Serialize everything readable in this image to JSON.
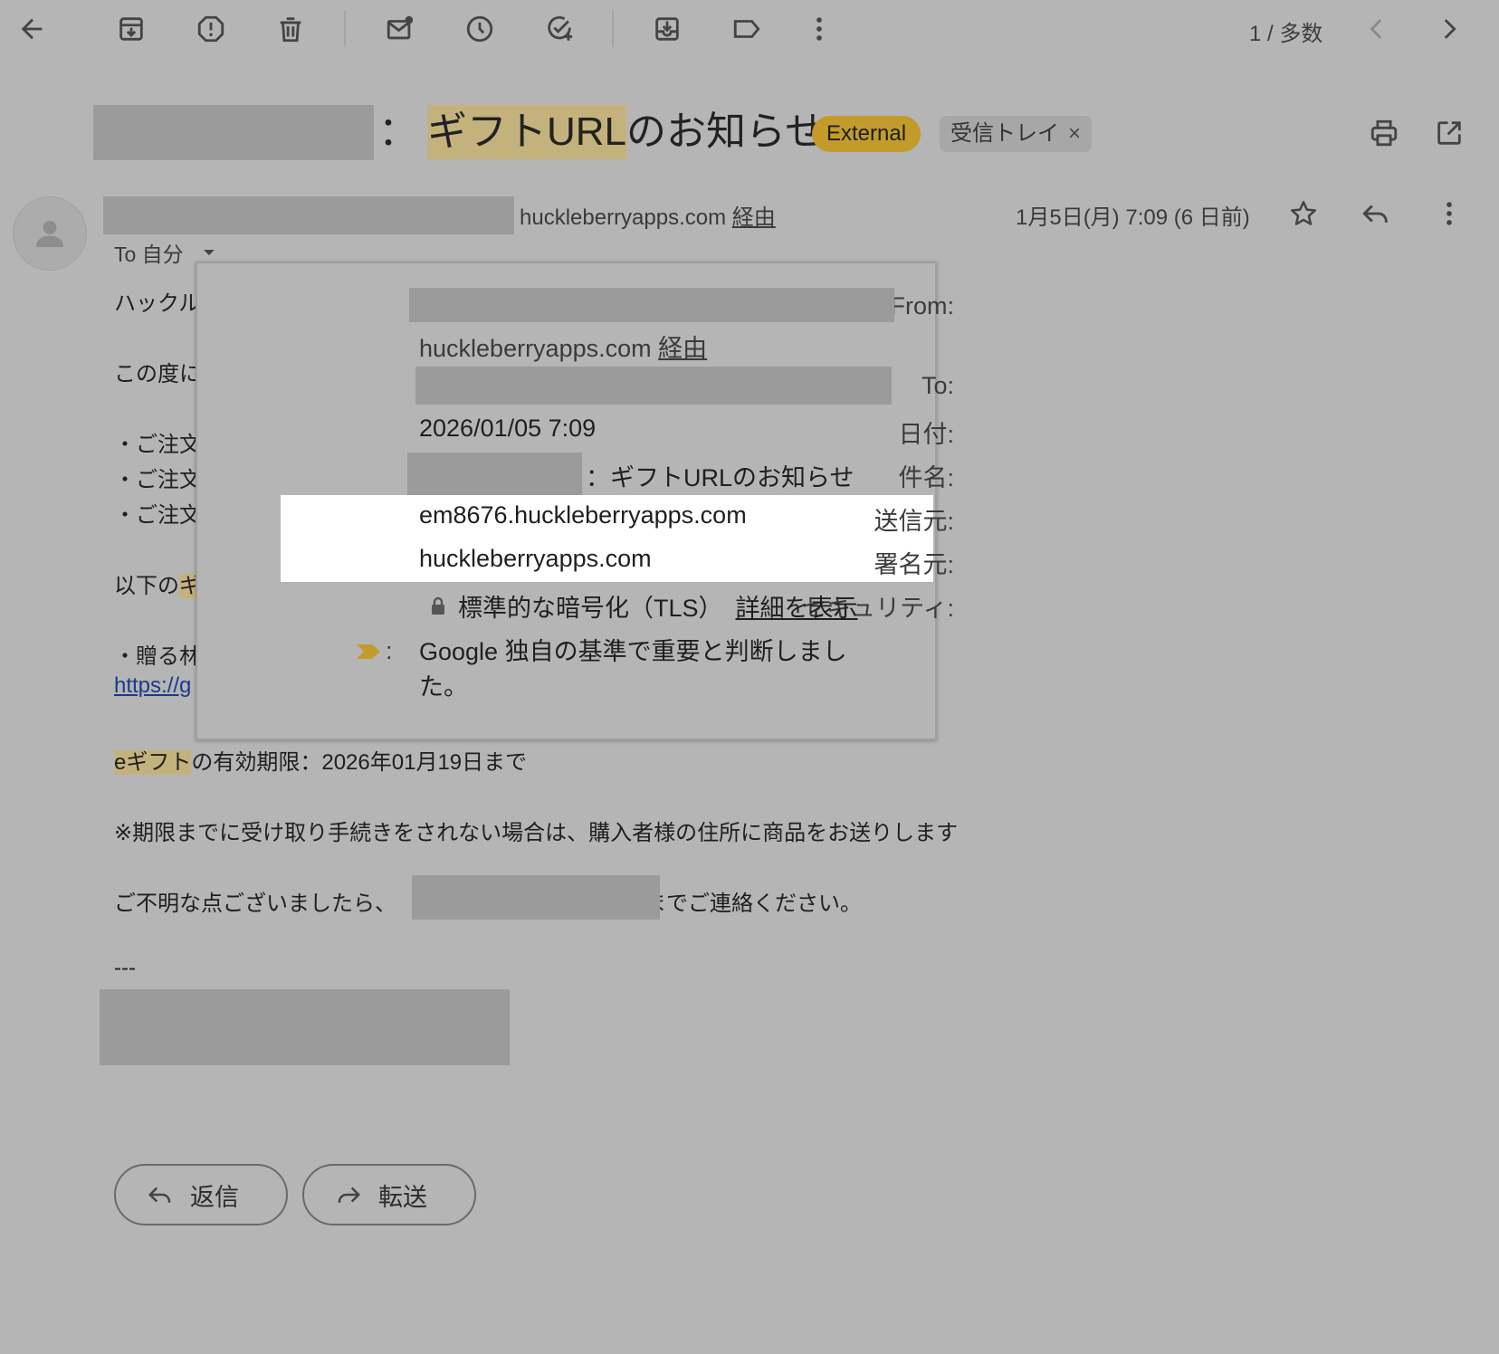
{
  "toolbar": {
    "page_counter": "1 / 多数"
  },
  "header": {
    "subject_sep": "：",
    "subject_hl": "ギフトURL",
    "subject_rest": "のお知らせ",
    "external_label": "External",
    "inbox_label": "受信トレイ",
    "inbox_close": "×"
  },
  "sender": {
    "via_domain": "huckleberryapps.com",
    "via_word": "経由",
    "date": "1月5日(月) 7:09 (6 日前)",
    "to_label": "To 自分"
  },
  "popup": {
    "from_label": "From:",
    "from_via_domain": "huckleberryapps.com",
    "from_via_word": "経由",
    "to_label": "To:",
    "date_label": "日付:",
    "date_value": "2026/01/05 7:09",
    "subject_label": "件名:",
    "subject_value": "：ギフトURLのお知らせ",
    "mailed_by_label": "送信元:",
    "mailed_by_value": "em8676.huckleberryapps.com",
    "signed_by_label": "署名元:",
    "signed_by_value": "huckleberryapps.com",
    "security_label": "セキュリティ:",
    "security_value": "標準的な暗号化（TLS）",
    "security_link": "詳細を表示",
    "importance_colon": ":",
    "importance_line1": "Google 独自の基準で重要と判断しまし",
    "importance_line2": "た。"
  },
  "body": {
    "line1": "ハックル",
    "line2": "この度に",
    "bullet1": "・ご注文",
    "bullet2": "・ご注文",
    "bullet3": "・ご注文",
    "line_below_pre": "以下の",
    "line_below_hl": "ギ",
    "gift_line": "・贈る林",
    "link": "https://g",
    "expiry_hl": "eギフト",
    "expiry_rest": "の有効期限：2026年01月19日まで",
    "notice": "※期限までに受け取り手続きをされない場合は、購入者様の住所に商品をお送りします",
    "contact_pre": "ご不明な点ございましたら、",
    "contact_post": "までご連絡ください。",
    "signature_sep": "---"
  },
  "actions": {
    "reply": "返信",
    "forward": "転送"
  },
  "colors": {
    "background": "#b5b5b5",
    "highlight": "#c4b27c",
    "external_badge": "#c39b2b",
    "link": "#1a3a8a"
  }
}
